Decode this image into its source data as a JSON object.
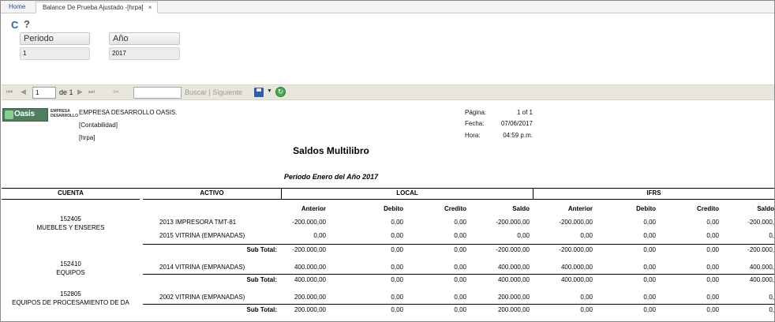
{
  "tabs": {
    "home": "Home",
    "active": "Balance De Prueba Ajustado -[hrpa]",
    "close": "×"
  },
  "params": {
    "periodo_label": "Periodo",
    "periodo_value": "1",
    "ano_label": "Año",
    "ano_value": "2017"
  },
  "toolbar": {
    "page_value": "1",
    "of_text": "de 1",
    "find_text": "Buscar | Siguiente",
    "first": "⏮",
    "prev": "◀",
    "next": "▶",
    "last": "⏭",
    "back": "⇦"
  },
  "report": {
    "logo_text": "Oasis",
    "logo_sub": "EMPRESA DESARROLLO",
    "company": "EMPRESA DESARROLLO OASIS.",
    "module": "[Contabilidad]",
    "code": "[hrpa]",
    "pagina_label": "Página:",
    "pagina_value": "1 of 1",
    "fecha_label": "Fecha:",
    "fecha_value": "07/06/2017",
    "hora_label": "Hora:",
    "hora_value": "04:59 p.m.",
    "title": "Saldos Multilibro",
    "period": "Periodo  Enero  del Año  2017",
    "headers": {
      "cuenta": "CUENTA",
      "activo": "ACTIVO",
      "local": "LOCAL",
      "ifrs": "IFRS"
    },
    "subheaders": [
      "Anterior",
      "Debito",
      "Credito",
      "Saldo",
      "Anterior",
      "Debito",
      "Credito",
      "Saldo"
    ],
    "groups": [
      {
        "code": "152405",
        "name": "MUEBLES Y ENSERES",
        "rows": [
          {
            "activo": "2013 IMPRESORA TMT-81",
            "vals": [
              "-200.000,00",
              "0,00",
              "0,00",
              "-200.000,00",
              "-200.000,00",
              "0,00",
              "0,00",
              "-200.000,"
            ]
          },
          {
            "activo": "2015 VITRINA (EMPANADAS)",
            "vals": [
              "0,00",
              "0,00",
              "0,00",
              "0,00",
              "0,00",
              "0,00",
              "0,00",
              "0,"
            ]
          }
        ],
        "subtotal": {
          "label": "Sub Total:",
          "vals": [
            "-200.000,00",
            "0,00",
            "0,00",
            "-200.000,00",
            "-200.000,00",
            "0,00",
            "0,00",
            "-200.000,"
          ]
        }
      },
      {
        "code": "152410",
        "name": "EQUIPOS",
        "rows": [
          {
            "activo": "2014 VITRINA (EMPANADAS)",
            "vals": [
              "400.000,00",
              "0,00",
              "0,00",
              "400.000,00",
              "400.000,00",
              "0,00",
              "0,00",
              "400.000,"
            ]
          }
        ],
        "subtotal": {
          "label": "Sub Total:",
          "vals": [
            "400.000,00",
            "0,00",
            "0,00",
            "400.000,00",
            "400.000,00",
            "0,00",
            "0,00",
            "400.000,"
          ]
        }
      },
      {
        "code": "152805",
        "name": "EQUIPOS DE PROCESAMIENTO DE DA",
        "rows": [
          {
            "activo": "2002 VITRINA (EMPANADAS)",
            "vals": [
              "200.000,00",
              "0,00",
              "0,00",
              "200.000,00",
              "0,00",
              "0,00",
              "0,00",
              "0,"
            ]
          }
        ],
        "subtotal": {
          "label": "Sub Total:",
          "vals": [
            "200.000,00",
            "0,00",
            "0,00",
            "200.000,00",
            "0,00",
            "0,00",
            "0,00",
            "0,"
          ]
        }
      }
    ]
  }
}
